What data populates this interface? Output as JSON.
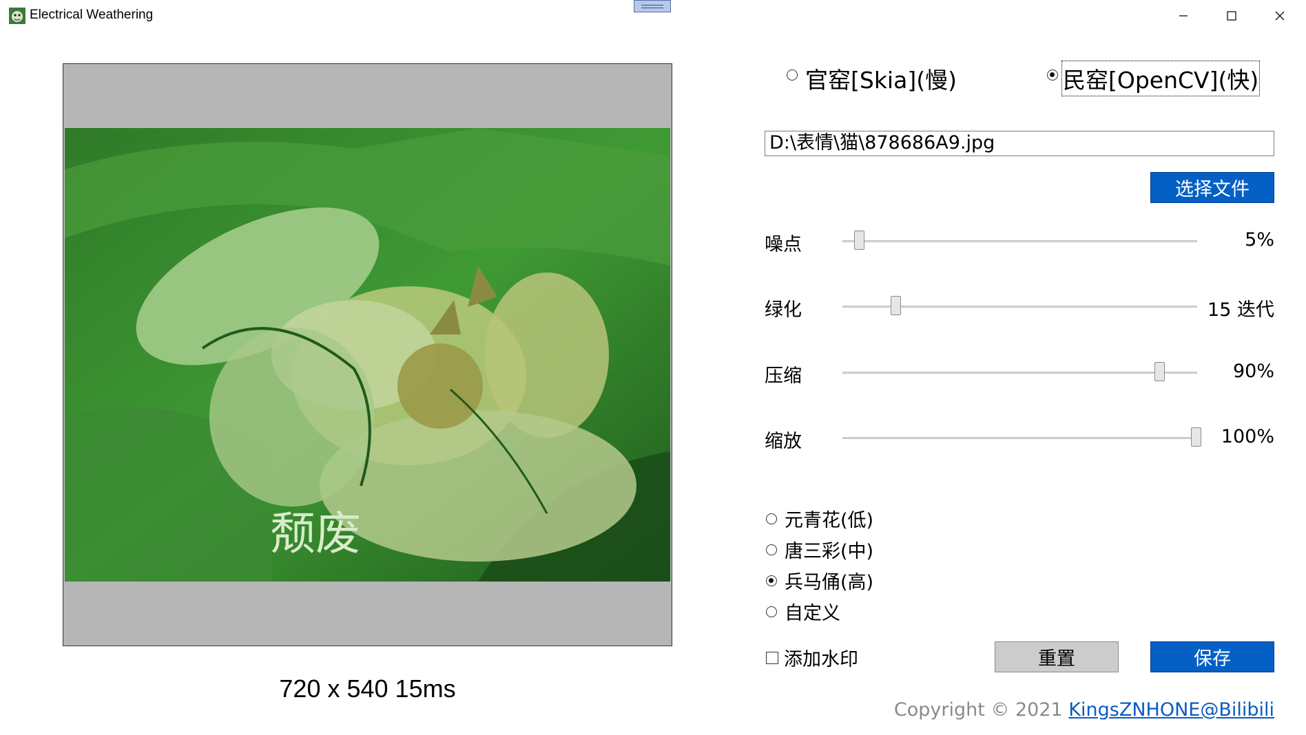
{
  "window": {
    "title": "Electrical Weathering",
    "icon": "cat-app-icon",
    "controls": [
      "minimize-icon",
      "maximize-icon",
      "close-icon"
    ]
  },
  "preview": {
    "overlay_text": "颓废",
    "info": "720 x 540  15ms"
  },
  "engine": {
    "options": [
      {
        "label": "官窑[Skia](慢)",
        "checked": false
      },
      {
        "label": "民窑[OpenCV](快)",
        "checked": true
      }
    ]
  },
  "file": {
    "path": "D:\\表情\\猫\\878686A9.jpg",
    "choose_label": "选择文件"
  },
  "sliders": [
    {
      "label": "噪点",
      "value_text": "5%",
      "level": 0.05
    },
    {
      "label": "绿化",
      "value_text": "15 迭代",
      "level": 0.15
    },
    {
      "label": "压缩",
      "value_text": "90%",
      "level": 0.9
    },
    {
      "label": "缩放",
      "value_text": "100%",
      "level": 1.0
    }
  ],
  "presets": [
    {
      "label": "元青花(低)",
      "checked": false
    },
    {
      "label": "唐三彩(中)",
      "checked": false
    },
    {
      "label": "兵马俑(高)",
      "checked": true
    },
    {
      "label": "自定义",
      "checked": false
    }
  ],
  "watermark": {
    "label": "添加水印",
    "checked": false
  },
  "actions": {
    "reset_label": "重置",
    "save_label": "保存"
  },
  "footer": {
    "copyright": "Copyright © 2021 ",
    "link": "KingsZNHONE@Bilibili"
  },
  "colors": {
    "accent": "#0460c4",
    "preview_bg": "#b6b6b6",
    "link": "#0a5bc4"
  }
}
